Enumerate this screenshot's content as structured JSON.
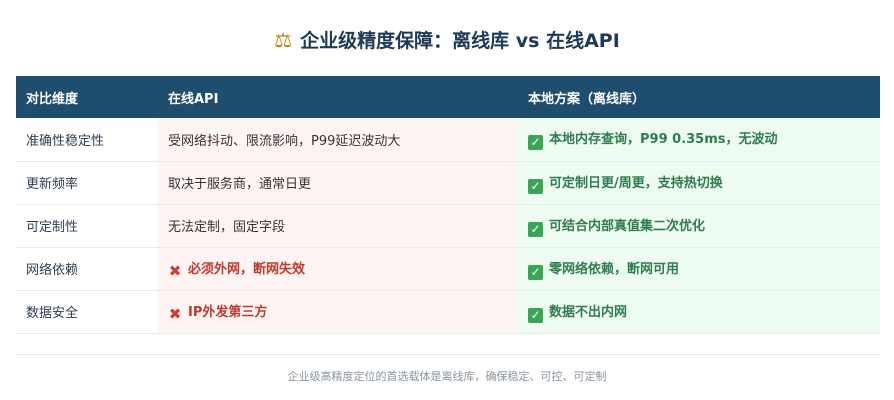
{
  "title": {
    "icon": "scale-balance-icon",
    "text": "企业级精度保障：离线库 vs 在线API"
  },
  "table": {
    "headers": [
      "对比维度",
      "在线API",
      "本地方案（离线库）"
    ],
    "rows": [
      {
        "dimension": "准确性稳定性",
        "api": "受网络抖动、限流影响，P99延迟波动大",
        "api_bad": false,
        "local": "本地内存查询，P99 0.35ms，无波动"
      },
      {
        "dimension": "更新频率",
        "api": "取决于服务商，通常日更",
        "api_bad": false,
        "local": "可定制日更/周更，支持热切换"
      },
      {
        "dimension": "可定制性",
        "api": "无法定制，固定字段",
        "api_bad": false,
        "local": "可结合内部真值集二次优化"
      },
      {
        "dimension": "网络依赖",
        "api": "必须外网，断网失效",
        "api_bad": true,
        "local": "零网络依赖，断网可用"
      },
      {
        "dimension": "数据安全",
        "api": "IP外发第三方",
        "api_bad": true,
        "local": "数据不出内网"
      }
    ]
  },
  "footnote": "企业级高精度定位的首选载体是离线库，确保稳定、可控、可定制",
  "colors": {
    "header_bg": "#1e4d6e",
    "title": "#1d3a57",
    "api_bg": "#fff4f4",
    "local_bg": "#eefbf1",
    "local_text": "#2e7d4f",
    "bad_text": "#c0392b",
    "check": "#3aa655",
    "cross": "#d63a2f"
  }
}
